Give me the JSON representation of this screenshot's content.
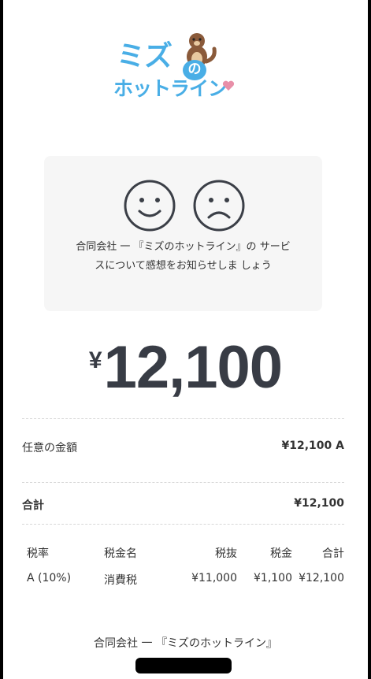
{
  "logo": {
    "line1": "ミズ",
    "no": "の",
    "line2": "ホットライン",
    "colors": {
      "text": "#49aee6",
      "heart": "#e88fa8",
      "otter": "#8a5a3a"
    }
  },
  "feedback": {
    "good_icon": "smile-face-icon",
    "bad_icon": "frown-face-icon",
    "message": "合同会社 一 『ミズのホットライン』の サービスについて感想をお知らせしま しょう"
  },
  "total": {
    "currency": "¥",
    "amount": "12,100"
  },
  "line_items": [
    {
      "label": "任意の金額",
      "value": "¥12,100 A"
    }
  ],
  "summary": {
    "label": "合計",
    "value": "¥12,100"
  },
  "tax_table": {
    "headers": [
      "税率",
      "税金名",
      "税抜",
      "税金",
      "合計"
    ],
    "rows": [
      [
        "A (10%)",
        "消費税",
        "¥11,000",
        "¥1,100",
        "¥12,100"
      ]
    ]
  },
  "footer": {
    "merchant": "合同会社 一 『ミズのホットライン』"
  }
}
